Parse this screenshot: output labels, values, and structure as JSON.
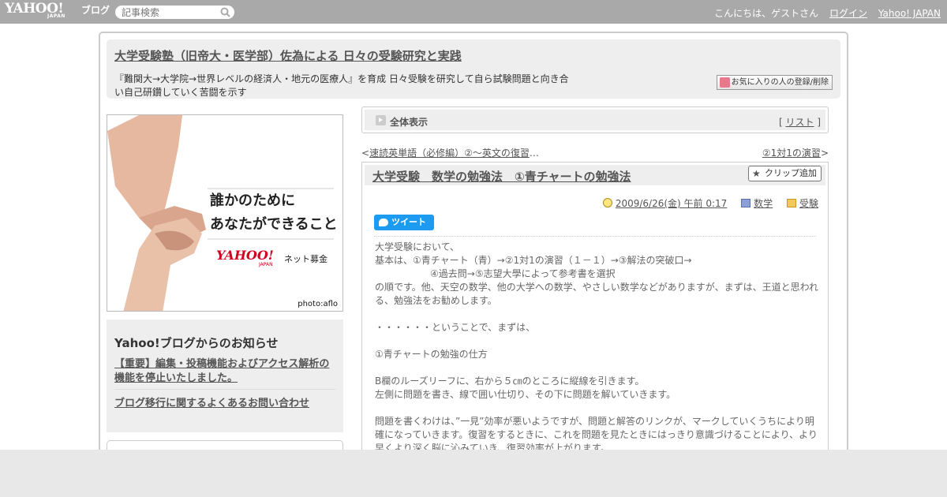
{
  "topbar": {
    "logo": "YAHOO!",
    "logo_sub": "JAPAN",
    "service": "ブログ",
    "search_placeholder": "記事検索",
    "greeting": "こんにちは、ゲストさん",
    "login": "ログイン",
    "yahoo_japan": "Yahoo! JAPAN"
  },
  "blog": {
    "title": "大学受験塾（旧帝大・医学部）佐為による 日々の受験研究と実践",
    "description": "『難関大→大学院→世界レベルの経済人・地元の医療人』を育成 日々受験を研究して自ら試験問題と向き合い自己研鑽していく苦闘を示す",
    "fav_button": "お気に入りの人の登録/削除"
  },
  "banner": {
    "line1": "誰かのために",
    "line2": "あなたができること",
    "logo": "YAHOO!",
    "logo_sub": "JAPAN",
    "service": "ネット募金",
    "credit": "photo:aflo"
  },
  "notice": {
    "title": "Yahoo!ブログからのお知らせ",
    "link1": "【重要】編集・投稿機能およびアクセス解析の機能を停止いたしました。",
    "link2": "ブログ移行に関するよくあるお問い合わせ"
  },
  "viewbar": {
    "label": "全体表示",
    "list_prefix": "[ ",
    "list_link": "リスト",
    "list_suffix": " ]"
  },
  "nav": {
    "prev_mark": "<",
    "prev_link": "速読英単語（必修編）②～英文の復習",
    "prev_ellipsis": "…",
    "next_link": "②1対1の演習",
    "next_mark": ">"
  },
  "article": {
    "title": "大学受験　数学の勉強法　①青チャートの勉強法",
    "clip_button": "クリップ追加",
    "date": "2009/6/26(金) 午前 0:17",
    "category1": "数学",
    "category2": "受験",
    "tweet": "ツイート",
    "lines": [
      "大学受験において、",
      "基本は、①青チャート（青）→②1対1の演習（１－１）→③解法の突破口→",
      "④過去問→⑤志望大學によって参考書を選択",
      "の順です。他、天空の数学、他の大学への数学、やさしい数学などがありますが、まずは、王道と思われる、勉強法をお勧めします。",
      "",
      "・・・・・・ということで、まずは、",
      "",
      "①青チャートの勉強の仕方",
      "",
      "B欄のルーズリーフに、右から５㎝のところに縦線を引きます。",
      "左側に問題を書き、線で囲い仕切り、その下に問題を解いていきます。",
      "",
      "問題を書くわけは、”一見”効率が悪いようですが、問題と解答のリンクが、マークしていくうちにより明確になっていきます。復習をするときに、これを問題を見たときにはっきり意識づけることにより、より早くより深く脳に沁みていき、復習効率が上がります。"
    ]
  }
}
